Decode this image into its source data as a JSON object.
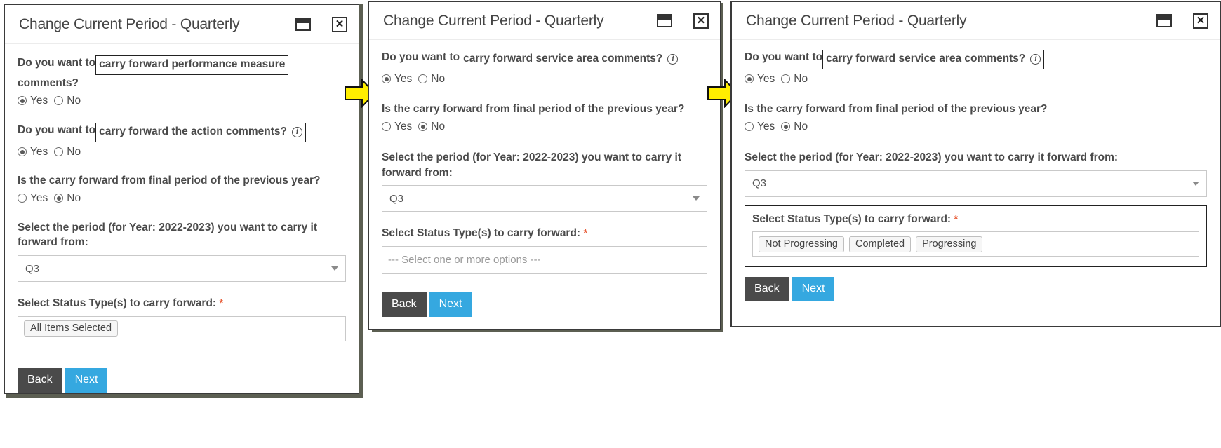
{
  "colors": {
    "accent_next": "#35a8e0",
    "back_button": "#4a4a4a",
    "required_star": "#e8603c",
    "arrow": "#ffee00",
    "text": "#4a4a4a",
    "border_highlight": "#222222"
  },
  "common": {
    "title": "Change Current Period - Quarterly",
    "restore_icon": "restore-window-icon",
    "close_icon": "close-window-icon",
    "info_icon": "info-circle-icon",
    "yes_label": "Yes",
    "no_label": "No",
    "back_label": "Back",
    "next_label": "Next",
    "period_label": "Select the period (for Year: 2022-2023) you want to carry it forward from:",
    "period_value": "Q3",
    "status_label": "Select Status Type(s) to carry forward:",
    "required_marker": "*",
    "final_period_question": "Is the carry forward from final period of the previous year?",
    "lead_text": "Do you want to"
  },
  "panels": [
    {
      "id": "panel-1",
      "title": "Change Current Period - Quarterly",
      "questions": [
        {
          "lead": "Do you want to",
          "boxed": "carry forward performance measure",
          "tail": "comments?",
          "has_info": false,
          "yes_selected": true,
          "no_selected": false
        },
        {
          "lead": "Do you want to",
          "boxed": "carry forward the action comments?",
          "tail": "",
          "has_info": true,
          "yes_selected": true,
          "no_selected": false
        }
      ],
      "final_period": {
        "label": "Is the carry forward from final period of the previous year?",
        "yes_selected": false,
        "no_selected": true
      },
      "period": {
        "label": "Select the period (for Year: 2022-2023) you want to carry it forward from:",
        "value": "Q3"
      },
      "status": {
        "label": "Select Status Type(s) to carry forward:",
        "required": "*",
        "boxed_group": false,
        "chips": [
          "All Items Selected"
        ],
        "placeholder": ""
      },
      "buttons": {
        "back": "Back",
        "next": "Next"
      }
    },
    {
      "id": "panel-2",
      "title": "Change Current Period - Quarterly",
      "questions": [
        {
          "lead": "Do you want to",
          "boxed": "carry forward service area comments?",
          "tail": "",
          "has_info": true,
          "yes_selected": true,
          "no_selected": false
        }
      ],
      "final_period": {
        "label": "Is the carry forward from final period of the previous year?",
        "yes_selected": false,
        "no_selected": true
      },
      "period": {
        "label": "Select the period (for Year: 2022-2023) you want to carry it forward from:",
        "value": "Q3"
      },
      "status": {
        "label": "Select Status Type(s) to carry forward:",
        "required": "*",
        "boxed_group": false,
        "chips": [],
        "placeholder": "--- Select one or more options ---"
      },
      "buttons": {
        "back": "Back",
        "next": "Next"
      }
    },
    {
      "id": "panel-3",
      "title": "Change Current Period - Quarterly",
      "questions": [
        {
          "lead": "Do you want to",
          "boxed": "carry forward service area comments?",
          "tail": "",
          "has_info": true,
          "yes_selected": true,
          "no_selected": false
        }
      ],
      "final_period": {
        "label": "Is the carry forward from final period of the previous year?",
        "yes_selected": false,
        "no_selected": true
      },
      "period": {
        "label": "Select the period (for Year: 2022-2023) you want to carry it forward from:",
        "value": "Q3"
      },
      "status": {
        "label": "Select Status Type(s) to carry forward:",
        "required": "*",
        "boxed_group": true,
        "chips": [
          "Not Progressing",
          "Completed",
          "Progressing"
        ],
        "placeholder": ""
      },
      "buttons": {
        "back": "Back",
        "next": "Next"
      }
    }
  ],
  "arrows": [
    {
      "name": "step-arrow-1-to-2"
    },
    {
      "name": "step-arrow-2-to-3"
    }
  ]
}
